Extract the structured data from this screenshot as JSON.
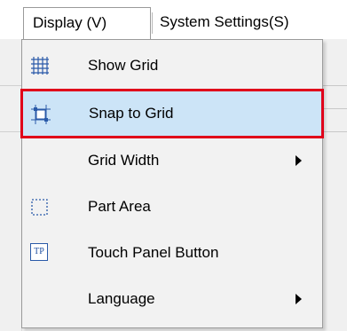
{
  "menubar": {
    "display_label": "Display (V)",
    "system_label": "System Settings(S)"
  },
  "dropdown": {
    "items": [
      {
        "label": "Show Grid",
        "icon": "grid-icon",
        "has_submenu": false,
        "highlighted": false
      },
      {
        "label": "Snap to Grid",
        "icon": "snap-to-grid-icon",
        "has_submenu": false,
        "highlighted": true
      },
      {
        "label": "Grid Width",
        "icon": null,
        "has_submenu": true,
        "highlighted": false
      },
      {
        "label": "Part Area",
        "icon": "dashed-rectangle-icon",
        "has_submenu": false,
        "highlighted": false
      },
      {
        "label": "Touch Panel Button",
        "icon": "touch-panel-icon",
        "has_submenu": false,
        "highlighted": false
      },
      {
        "label": "Language",
        "icon": null,
        "has_submenu": true,
        "highlighted": false
      }
    ]
  },
  "icons": {
    "touch_panel_text": "TP"
  },
  "colors": {
    "highlight_fill": "#cce4f7",
    "highlight_border": "#90c8f6",
    "annotation_red": "#e0001a",
    "grid_icon_blue": "#2a5aa8"
  }
}
